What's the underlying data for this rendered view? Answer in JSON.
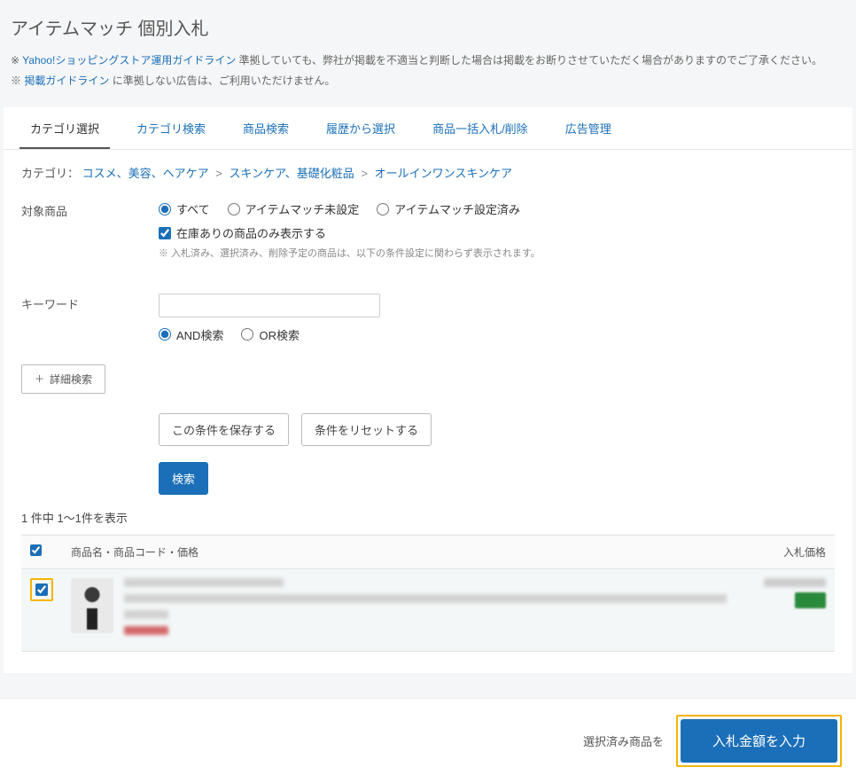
{
  "page": {
    "title": "アイテムマッチ 個別入札",
    "notice1_prefix": "※ ",
    "notice1_link": "Yahoo!ショッピングストア運用ガイドライン",
    "notice1_suffix": " 準拠していても、弊社が掲載を不適当と判断した場合は掲載をお断りさせていただく場合がありますのでご了承ください。",
    "notice2_prefix": "※ ",
    "notice2_link": "掲載ガイドライン",
    "notice2_suffix": " に準拠しない広告は、ご利用いただけません。"
  },
  "tabs": {
    "t0": "カテゴリ選択",
    "t1": "カテゴリ検索",
    "t2": "商品検索",
    "t3": "履歴から選択",
    "t4": "商品一括入札/削除",
    "t5": "広告管理"
  },
  "breadcrumb": {
    "label": "カテゴリ：",
    "c0": "コスメ、美容、ヘアケア",
    "c1": "スキンケア、基礎化粧品",
    "c2": "オールインワンスキンケア",
    "sep": ">"
  },
  "filter": {
    "target_label": "対象商品",
    "opt_all": "すべて",
    "opt_unset": "アイテムマッチ未設定",
    "opt_set": "アイテムマッチ設定済み",
    "stock_only": "在庫ありの商品のみ表示する",
    "helper": "※ 入札済み、選択済み、削除予定の商品は、以下の条件設定に関わらず表示されます。",
    "keyword_label": "キーワード",
    "opt_and": "AND検索",
    "opt_or": "OR検索",
    "adv_search": "詳細検索",
    "save_cond": "この条件を保存する",
    "reset_cond": "条件をリセットする",
    "search": "検索"
  },
  "results": {
    "count_text": "1 件中 1〜1件を表示",
    "col_product": "商品名・商品コード・価格",
    "col_price": "入札価格"
  },
  "footer": {
    "label": "選択済み商品を",
    "button": "入札金額を入力"
  }
}
